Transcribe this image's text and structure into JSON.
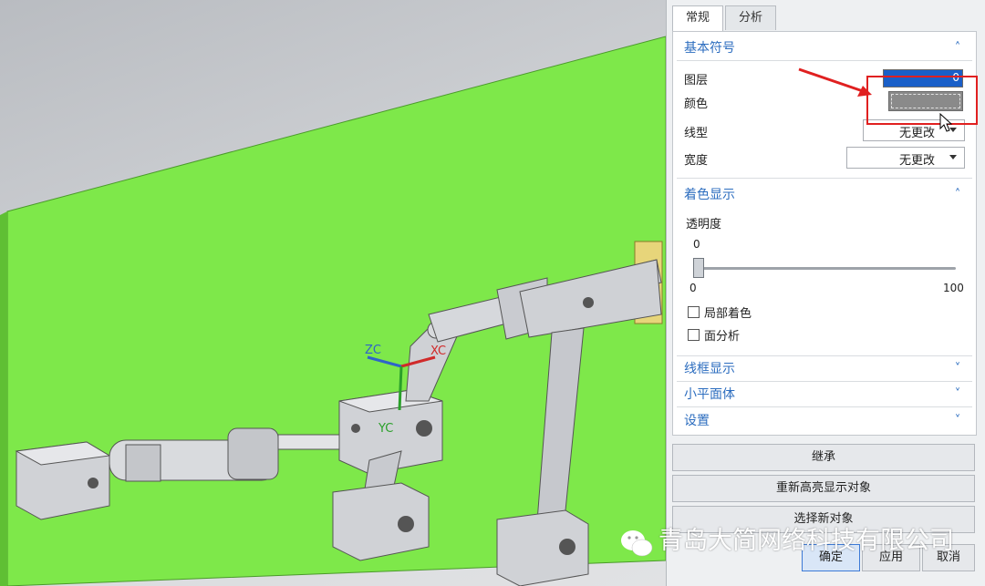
{
  "viewport": {
    "triad": {
      "zc": "ZC",
      "xc": "XC",
      "yc": "YC"
    },
    "colors": {
      "plate": "#7ee84a",
      "parts": "#c9cbd0",
      "zc": "#2f64c8",
      "xc": "#d02a2a",
      "yc": "#2aa02a"
    }
  },
  "panel": {
    "tabs": [
      {
        "label": "常规"
      },
      {
        "label": "分析"
      }
    ],
    "basic_symbol": {
      "title": "基本符号",
      "layer_label": "图层",
      "layer_value": "0",
      "color_label": "颜色",
      "linetype_label": "线型",
      "linetype_value": "无更改",
      "width_label": "宽度",
      "width_value": "无更改"
    },
    "shading": {
      "title": "着色显示",
      "transparency_label": "透明度",
      "transparency_value": "0",
      "slider_min": "0",
      "slider_max": "100",
      "partial_shading_label": "局部着色",
      "face_analysis_label": "面分析"
    },
    "collapsed_sections": [
      {
        "title": "线框显示"
      },
      {
        "title": "小平面体"
      },
      {
        "title": "设置"
      }
    ],
    "buttons": {
      "inherit": "继承",
      "re_highlight": "重新高亮显示对象",
      "select_new": "选择新对象",
      "ok": "确定",
      "apply": "应用",
      "cancel": "取消"
    }
  },
  "watermark": {
    "text": "青岛大简网络科技有限公司"
  },
  "colors": {
    "accent": "#2c6dbf",
    "layer_swatch": "#1a5fc8",
    "color_swatch": "#8a8a8a",
    "highlight": "#e02020"
  }
}
